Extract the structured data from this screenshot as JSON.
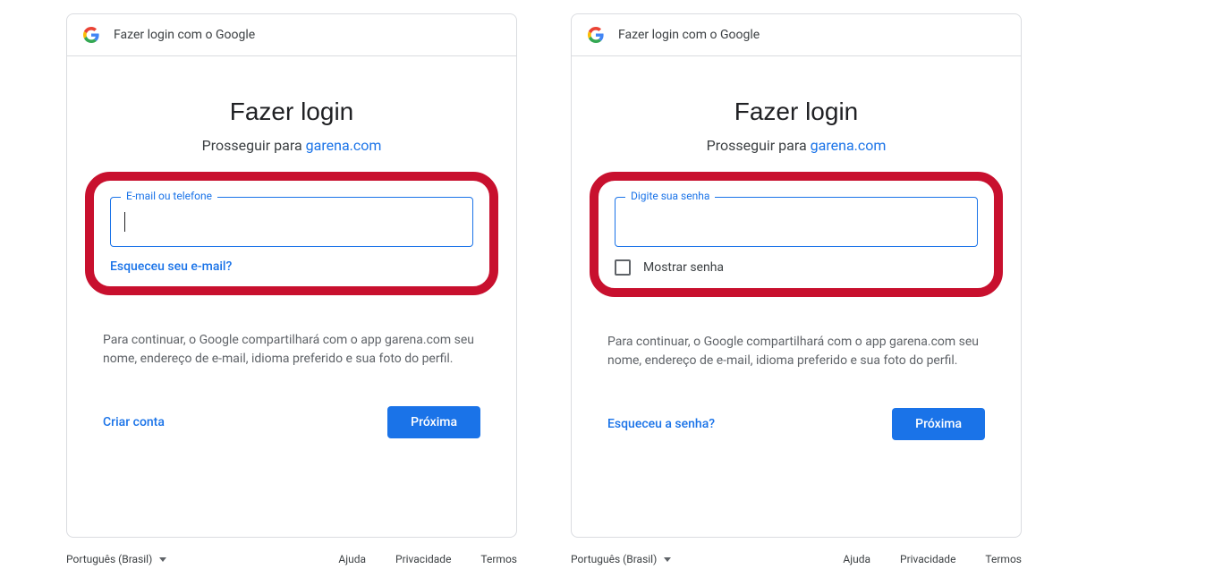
{
  "header": {
    "label": "Fazer login com o Google"
  },
  "common": {
    "title": "Fazer login",
    "subtitle_prefix": "Prosseguir para ",
    "app": "garena.com",
    "disclosure": "Para continuar, o Google compartilhará com o app garena.com seu nome, endereço de e-mail, idioma preferido e sua foto do perfil.",
    "primary_btn": "Próxima"
  },
  "left": {
    "field_label": "E-mail ou telefone",
    "forgot": "Esqueceu seu e-mail?",
    "secondary": "Criar conta"
  },
  "right": {
    "field_label": "Digite sua senha",
    "show_pw": "Mostrar senha",
    "secondary": "Esqueceu a senha?"
  },
  "footer": {
    "language": "Português (Brasil)",
    "help": "Ajuda",
    "privacy": "Privacidade",
    "terms": "Termos"
  }
}
